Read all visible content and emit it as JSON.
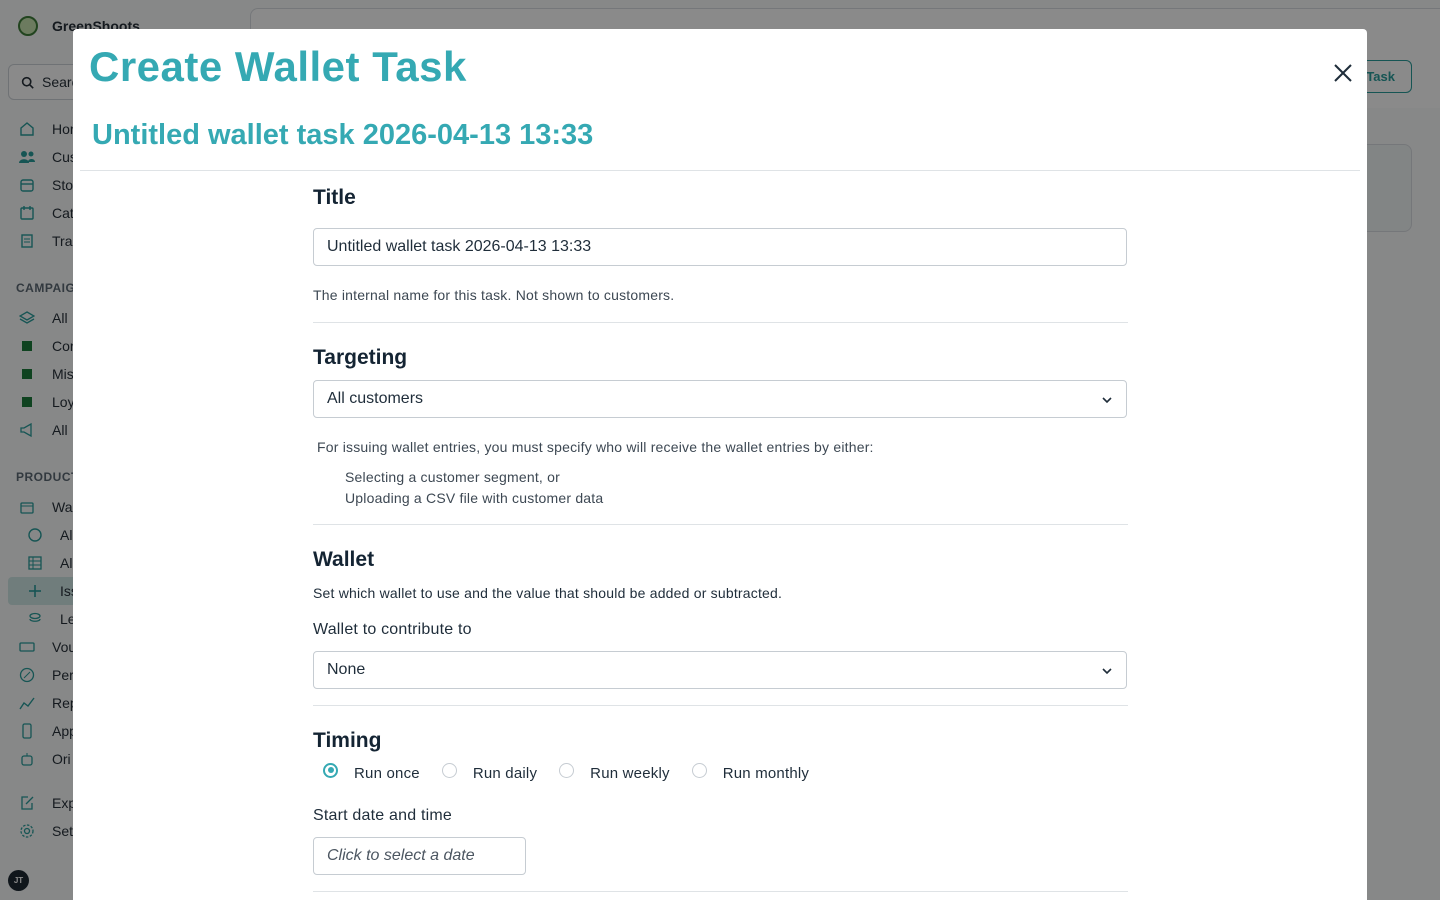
{
  "app": {
    "brand": "GreenShoots",
    "search_label": "Searc",
    "nav_top": [
      "Hor",
      "Cus",
      "Sto",
      "Cat",
      "Tra"
    ],
    "campaigns_label": "CAMPAIG",
    "nav_campaigns": [
      "All",
      "Cor",
      "Mis",
      "Loy",
      "All"
    ],
    "products_label": "PRODUCT",
    "nav_products": [
      "Wa",
      "Al",
      "Al",
      "Iss",
      "Le",
      "Vou",
      "Per",
      "Rep",
      "App",
      "Ori"
    ],
    "nav_bottom": [
      "Exp",
      "Set"
    ],
    "avatar_initials": "JT",
    "header_button": "Task"
  },
  "modal": {
    "title": "Create Wallet Task",
    "subtitle": "Untitled wallet task 2026-04-13 13:33",
    "title_section": {
      "heading": "Title",
      "value": "Untitled wallet task 2026-04-13 13:33",
      "help": "The internal name for this task. Not shown to customers."
    },
    "targeting": {
      "heading": "Targeting",
      "selected": "All customers",
      "help": "For issuing wallet entries, you must specify who will receive the wallet entries by either:",
      "options": [
        "Selecting a customer segment, or",
        "Uploading a CSV file with customer data"
      ]
    },
    "wallet": {
      "heading": "Wallet",
      "help": "Set which wallet to use and the value that should be added or subtracted.",
      "field_label": "Wallet to contribute to",
      "selected": "None"
    },
    "timing": {
      "heading": "Timing",
      "options": [
        "Run once",
        "Run daily",
        "Run weekly",
        "Run monthly"
      ],
      "selected_index": 0,
      "start_label": "Start date and time",
      "start_placeholder": "Click to select a date"
    }
  },
  "colors": {
    "accent": "#35a9b3",
    "heading": "#142433",
    "nav_active": "#cfe7e6"
  }
}
